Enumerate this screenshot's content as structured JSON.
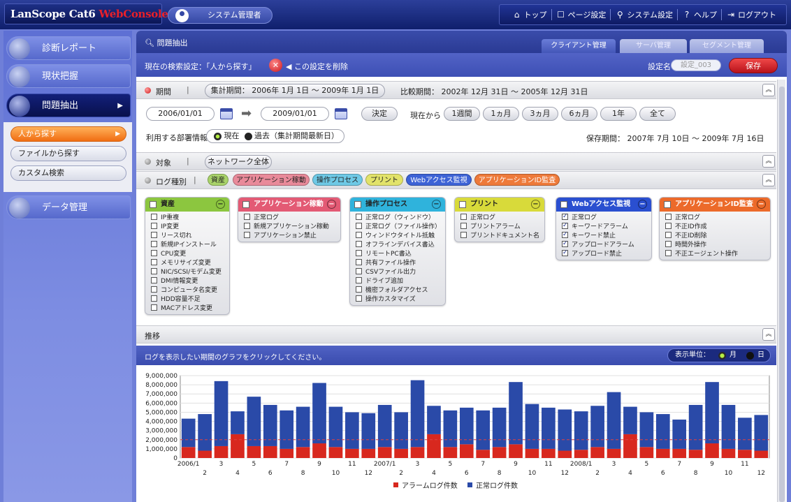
{
  "app": {
    "logo_main": "LanScope Cat6 ",
    "logo_accent": "WebConsole",
    "user": "システム管理者"
  },
  "topnav": [
    {
      "label": "トップ",
      "icon": "home-icon"
    },
    {
      "label": "ページ設定",
      "icon": "page-settings-icon"
    },
    {
      "label": "システム設定",
      "icon": "system-settings-icon"
    },
    {
      "label": "ヘルプ",
      "icon": "help-icon"
    },
    {
      "label": "ログアウト",
      "icon": "logout-icon"
    }
  ],
  "sidebar": {
    "items": [
      {
        "label": "診断レポート"
      },
      {
        "label": "現状把握"
      },
      {
        "label": "問題抽出",
        "active": true
      },
      {
        "label": "データ管理"
      }
    ],
    "sub": [
      {
        "label": "人から探す",
        "active": true
      },
      {
        "label": "ファイルから探す"
      },
      {
        "label": "カスタム検索"
      }
    ]
  },
  "main": {
    "title": "問題抽出",
    "tabs": [
      "クライアント管理",
      "サーバ管理",
      "セグメント管理"
    ],
    "search_label": "現在の検索設定：「人から探す」",
    "delete_label": "この設定を削除",
    "settings_name_label": "設定名",
    "settings_name_placeholder": "設定_003",
    "save": "保存"
  },
  "period": {
    "title": "期間",
    "agg_label": "集計期間：",
    "agg_value": "2006年 1月 1日 ～ 2009年 1月 1日",
    "cmp_label": "比較期間：",
    "cmp_value": "2002年 12月 31日 ～ 2005年 12月 31日",
    "from": "2006/01/01",
    "to": "2009/01/01",
    "decide": "決定",
    "from_now": "現在から",
    "quick": [
      "1週間",
      "1ヵ月",
      "3ヵ月",
      "6ヵ月",
      "1年",
      "全て"
    ],
    "dept_label": "利用する部署情報",
    "dept_current": "現在",
    "dept_past": "過去（集計期間最新日）",
    "retention": "保存期間： 2007年 7月 10日 ～ 2009年 7月 16日"
  },
  "target": {
    "title": "対象",
    "value": "ネットワーク全体"
  },
  "logtype": {
    "title": "ログ種別",
    "tags": [
      {
        "label": "資産",
        "color": "#a9d36a"
      },
      {
        "label": "アプリケーション稼動",
        "color": "#e98a9a"
      },
      {
        "label": "操作プロセス",
        "color": "#6ec9e6"
      },
      {
        "label": "プリント",
        "color": "#e2e36a"
      },
      {
        "label": "Webアクセス監視",
        "color": "#3d63d6"
      },
      {
        "label": "アプリケーションID監査",
        "color": "#ee7a3a"
      }
    ]
  },
  "cards": [
    {
      "title": "資産",
      "color": "#8cc63f",
      "items": [
        "IP重複",
        "IP変更",
        "リース切れ",
        "新規IPインストール",
        "CPU変更",
        "メモリサイズ変更",
        "NIC/SCSI/モデム変更",
        "DMI情報変更",
        "コンピュータ名変更",
        "HDD容量不足",
        "MACアドレス変更"
      ],
      "checked": false
    },
    {
      "title": "アプリケーション稼動",
      "color": "#e35a74",
      "items": [
        "正常ログ",
        "新規アプリケーション稼動",
        "アプリケーション禁止"
      ],
      "checked": false
    },
    {
      "title": "操作プロセス",
      "color": "#2fb3dc",
      "items": [
        "正常ログ（ウィンドウ）",
        "正常ログ（ファイル操作）",
        "ウィンドウタイトル抵触",
        "オフラインデバイス書込",
        "リモートPC書込",
        "共有ファイル操作",
        "CSVファイル出力",
        "ドライブ追加",
        "機密フォルダアクセス",
        "操作カスタマイズ"
      ],
      "checked": false
    },
    {
      "title": "プリント",
      "color": "#d8da3a",
      "items": [
        "正常ログ",
        "プリントアラーム",
        "プリントドキュメント名"
      ],
      "checked": false
    },
    {
      "title": "Webアクセス監視",
      "color": "#2a4fd0",
      "items": [
        "正常ログ",
        "キーワードアラーム",
        "キーワード禁止",
        "アップロードアラーム",
        "アップロード禁止"
      ],
      "checked": true
    },
    {
      "title": "アプリケーションID監査",
      "color": "#ec6a2a",
      "items": [
        "正常ログ",
        "不正ID作成",
        "不正ID削除",
        "時間外操作",
        "不正エージェント操作"
      ],
      "checked": false
    }
  ],
  "trend": {
    "title": "推移",
    "hint": "ログを表示したい期間のグラフをクリックしてください。",
    "unit_label": "表示単位：",
    "unit_month": "月",
    "unit_day": "日"
  },
  "chart_data": {
    "type": "bar",
    "stacked": true,
    "ylim": [
      0,
      9000000
    ],
    "yticks": [
      "0",
      "1,000,000",
      "2,000,000",
      "3,000,000",
      "4,000,000",
      "5,000,000",
      "6,000,000",
      "7,000,000",
      "8,000,000",
      "9,000,000"
    ],
    "x_labels": [
      "2006/1",
      "2",
      "3",
      "4",
      "5",
      "6",
      "7",
      "8",
      "9",
      "10",
      "11",
      "12",
      "2007/1",
      "2",
      "3",
      "4",
      "5",
      "6",
      "7",
      "8",
      "9",
      "10",
      "11",
      "12",
      "2008/1",
      "2",
      "3",
      "4",
      "5",
      "6",
      "7",
      "8",
      "9",
      "10",
      "11",
      "12"
    ],
    "series": [
      {
        "name": "アラームログ件数",
        "color": "#d8281e",
        "values": [
          1200000,
          800000,
          1300000,
          2600000,
          1300000,
          1300000,
          1000000,
          1200000,
          1600000,
          1200000,
          1000000,
          1000000,
          1200000,
          1000000,
          1200000,
          2600000,
          1200000,
          1500000,
          900000,
          1200000,
          1500000,
          1000000,
          1000000,
          800000,
          900000,
          1200000,
          1000000,
          2600000,
          1200000,
          1000000,
          1000000,
          900000,
          1600000,
          1000000,
          900000,
          800000
        ]
      },
      {
        "name": "正常ログ件数",
        "color": "#2a4aa8",
        "values": [
          3100000,
          4000000,
          7100000,
          2500000,
          5400000,
          4500000,
          4200000,
          4400000,
          6600000,
          4400000,
          4000000,
          3900000,
          4600000,
          4000000,
          7300000,
          3100000,
          4000000,
          4000000,
          4300000,
          4300000,
          6800000,
          4900000,
          4500000,
          4500000,
          4200000,
          4500000,
          6200000,
          3000000,
          3800000,
          3800000,
          3200000,
          4900000,
          6700000,
          4800000,
          3500000,
          3900000
        ]
      }
    ]
  }
}
